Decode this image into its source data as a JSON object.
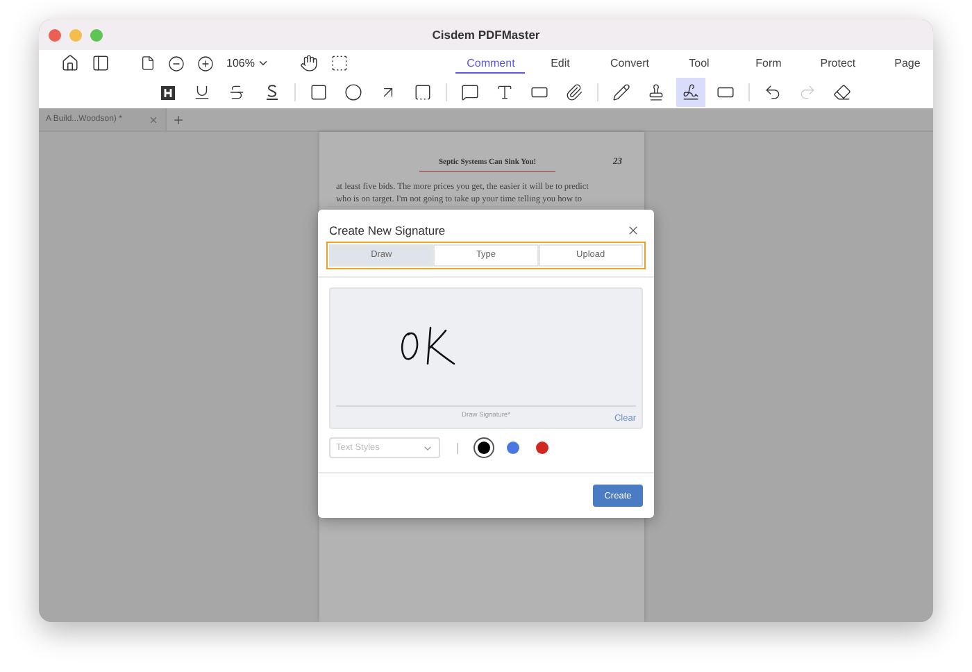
{
  "window": {
    "title": "Cisdem PDFMaster"
  },
  "toolbar": {
    "zoom": "106%"
  },
  "mode_tabs": [
    {
      "label": "Comment",
      "selected": true
    },
    {
      "label": "Edit",
      "selected": false
    },
    {
      "label": "Convert",
      "selected": false
    },
    {
      "label": "Tool",
      "selected": false
    },
    {
      "label": "Form",
      "selected": false
    },
    {
      "label": "Protect",
      "selected": false
    },
    {
      "label": "Page",
      "selected": false
    }
  ],
  "annotation_tools": [
    {
      "kind": "highlight",
      "selected": false,
      "disabled": false
    },
    {
      "kind": "underline",
      "selected": false,
      "disabled": false
    },
    {
      "kind": "strikethrough",
      "selected": false,
      "disabled": false
    },
    {
      "kind": "squiggly",
      "selected": false,
      "disabled": false
    },
    {
      "kind": "rectangle",
      "selected": false,
      "disabled": false
    },
    {
      "kind": "circle",
      "selected": false,
      "disabled": false
    },
    {
      "kind": "arrow",
      "selected": false,
      "disabled": false
    },
    {
      "kind": "shapes",
      "selected": false,
      "disabled": false
    },
    {
      "kind": "note",
      "selected": false,
      "disabled": false
    },
    {
      "kind": "text",
      "selected": false,
      "disabled": false
    },
    {
      "kind": "textbox",
      "selected": false,
      "disabled": false
    },
    {
      "kind": "attachment",
      "selected": false,
      "disabled": false
    },
    {
      "kind": "pencil",
      "selected": false,
      "disabled": false
    },
    {
      "kind": "stamp",
      "selected": false,
      "disabled": false
    },
    {
      "kind": "signature",
      "selected": true,
      "disabled": false
    },
    {
      "kind": "field",
      "selected": false,
      "disabled": false
    },
    {
      "kind": "undo",
      "selected": false,
      "disabled": false
    },
    {
      "kind": "redo",
      "selected": false,
      "disabled": true
    },
    {
      "kind": "eraser",
      "selected": false,
      "disabled": false
    }
  ],
  "document_tabs": [
    {
      "label": "A Build...Woodson) *",
      "selected": true
    }
  ],
  "page": {
    "header": "Septic Systems Can Sink You!",
    "page_number": "23",
    "lines": [
      "at least five bids. The more prices you get, the easier it will be to predict",
      "who is on target. I'm not going to take up your time telling you how to"
    ]
  },
  "dialog": {
    "title": "Create New Signature",
    "tabs": [
      {
        "label": "Draw",
        "selected": true
      },
      {
        "label": "Type",
        "selected": false
      },
      {
        "label": "Upload",
        "selected": false
      }
    ],
    "pad_label": "Draw Signature*",
    "clear": "Clear",
    "text_styles": {
      "placeholder": "Text Styles"
    },
    "colors": [
      {
        "color": "#000000",
        "selected": true
      },
      {
        "color": "#4a78e0",
        "selected": false
      },
      {
        "color": "#d0281f",
        "selected": false
      }
    ],
    "create": "Create"
  }
}
